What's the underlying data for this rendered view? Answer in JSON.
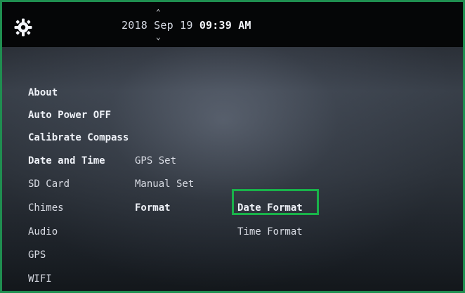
{
  "header": {
    "settings_icon": "gear-icon",
    "datetime": {
      "year": "2018",
      "month": "Sep",
      "day": "19",
      "time": "09:39 AM"
    }
  },
  "menu": {
    "categories": [
      {
        "label": "About"
      },
      {
        "label": "Auto Power OFF"
      },
      {
        "label": "Calibrate Compass"
      },
      {
        "label": "Date and Time"
      },
      {
        "label": "SD Card"
      },
      {
        "label": "Chimes"
      },
      {
        "label": "Audio"
      },
      {
        "label": "GPS"
      },
      {
        "label": "WIFI"
      }
    ],
    "date_time_options": [
      {
        "label": "GPS Set"
      },
      {
        "label": "Manual Set"
      },
      {
        "label": "Format"
      }
    ],
    "format_options": [
      {
        "label": "Date Format",
        "selected": true
      },
      {
        "label": "Time Format",
        "selected": false
      }
    ]
  },
  "colors": {
    "selection": "#19b24a"
  }
}
